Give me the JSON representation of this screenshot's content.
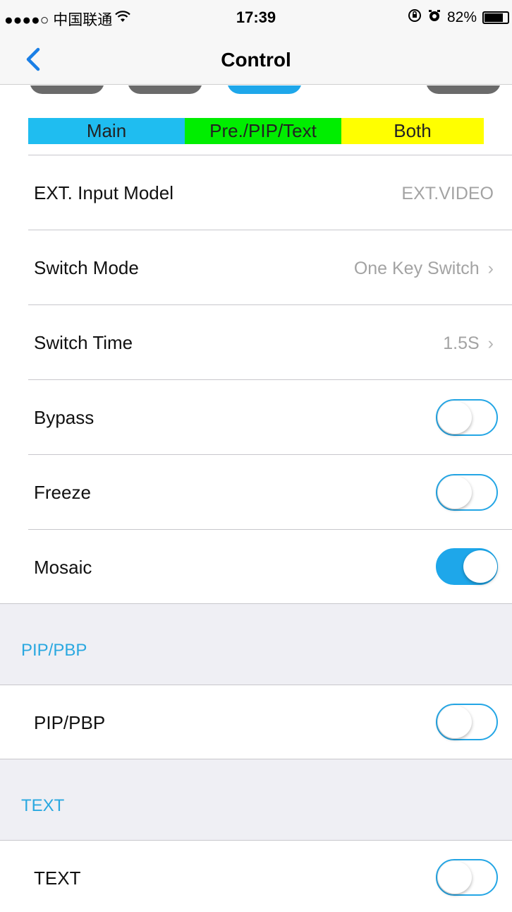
{
  "status_bar": {
    "carrier": "●●●●○ 中国联通",
    "wifi": "wifi-icon",
    "time": "17:39",
    "battery_percent": "82%",
    "battery_level": 0.82
  },
  "nav": {
    "back_icon": "chevron-left-icon",
    "title": "Control"
  },
  "legend": [
    {
      "label": "Main",
      "color": "#1fbdf0"
    },
    {
      "label": "Pre./PIP/Text",
      "color": "#00ee00"
    },
    {
      "label": "Both",
      "color": "#ffff00"
    }
  ],
  "rows": {
    "ext_input": {
      "label": "EXT. Input Model",
      "value": "EXT.VIDEO"
    },
    "switch_mode": {
      "label": "Switch Mode",
      "value": "One Key Switch"
    },
    "switch_time": {
      "label": "Switch Time",
      "value": "1.5S"
    },
    "bypass": {
      "label": "Bypass",
      "on": false
    },
    "freeze": {
      "label": "Freeze",
      "on": false
    },
    "mosaic": {
      "label": "Mosaic",
      "on": true
    }
  },
  "sections": {
    "pip": {
      "title": "PIP/PBP",
      "row_label": "PIP/PBP",
      "on": false
    },
    "text": {
      "title": "TEXT",
      "row_label": "TEXT",
      "on": false
    }
  },
  "accent_color": "#1ea7ea"
}
